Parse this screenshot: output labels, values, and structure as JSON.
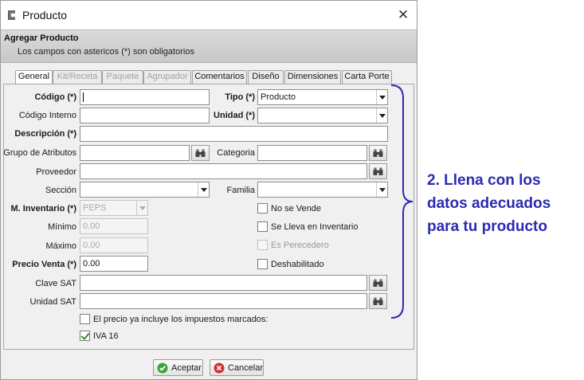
{
  "window": {
    "title": "Producto",
    "close_glyph": "✕"
  },
  "header": {
    "title": "Agregar Producto",
    "subtitle": "Los campos con astericos (*) son obligatorios"
  },
  "tabs": [
    {
      "label": "General",
      "state": "active"
    },
    {
      "label": "Kit/Receta",
      "state": "disabled"
    },
    {
      "label": "Paquete",
      "state": "disabled"
    },
    {
      "label": "Agrupador",
      "state": "disabled"
    },
    {
      "label": "Comentarios",
      "state": "enabled"
    },
    {
      "label": "Diseño",
      "state": "enabled"
    },
    {
      "label": "Dimensiones",
      "state": "enabled"
    },
    {
      "label": "Carta Porte",
      "state": "enabled"
    }
  ],
  "form": {
    "codigo_label": "Código (*)",
    "codigo_value": "",
    "tipo_label": "Tipo (*)",
    "tipo_value": "Producto",
    "codigo_interno_label": "Código Interno",
    "codigo_interno_value": "",
    "unidad_label": "Unidad (*)",
    "unidad_value": "",
    "descripcion_label": "Descripción (*)",
    "descripcion_value": "",
    "grupo_atributos_label": "Grupo de Atributos",
    "grupo_atributos_value": "",
    "categoria_label": "Categoria",
    "categoria_value": "",
    "proveedor_label": "Proveedor",
    "proveedor_value": "",
    "seccion_label": "Sección",
    "seccion_value": "",
    "familia_label": "Familia",
    "familia_value": "",
    "inventario_label": "M. Inventario (*)",
    "inventario_value": "PEPS",
    "minimo_label": "Mínimo",
    "minimo_value": "0.00",
    "maximo_label": "Máximo",
    "maximo_value": "0.00",
    "precio_label": "Precio Venta (*)",
    "precio_value": "0.00",
    "clave_sat_label": "Clave SAT",
    "clave_sat_value": "",
    "unidad_sat_label": "Unidad SAT",
    "unidad_sat_value": ""
  },
  "checkboxes": {
    "no_se_vende": {
      "label": "No se Vende",
      "checked": false
    },
    "lleva_inventario": {
      "label": "Se Lleva en Inventario",
      "checked": false
    },
    "perecedero": {
      "label": "Es Perecedero",
      "checked": false,
      "disabled": true
    },
    "deshabilitado": {
      "label": "Deshabilitado",
      "checked": false
    },
    "precio_incluye": {
      "label": "El precio ya incluye los impuestos marcados:",
      "checked": false
    },
    "iva16": {
      "label": "IVA 16",
      "checked": true
    }
  },
  "buttons": {
    "aceptar": "Aceptar",
    "cancelar": "Cancelar"
  },
  "annotation": {
    "line1": "2. Llena con los",
    "line2": "datos adecuados",
    "line3": "para tu producto"
  },
  "colors": {
    "annotation": "#2b2baf",
    "accept_icon": "#3aa53a",
    "cancel_icon": "#d23030"
  },
  "icons": {
    "picker": "binoculars-icon",
    "app": "app-window-icon"
  }
}
